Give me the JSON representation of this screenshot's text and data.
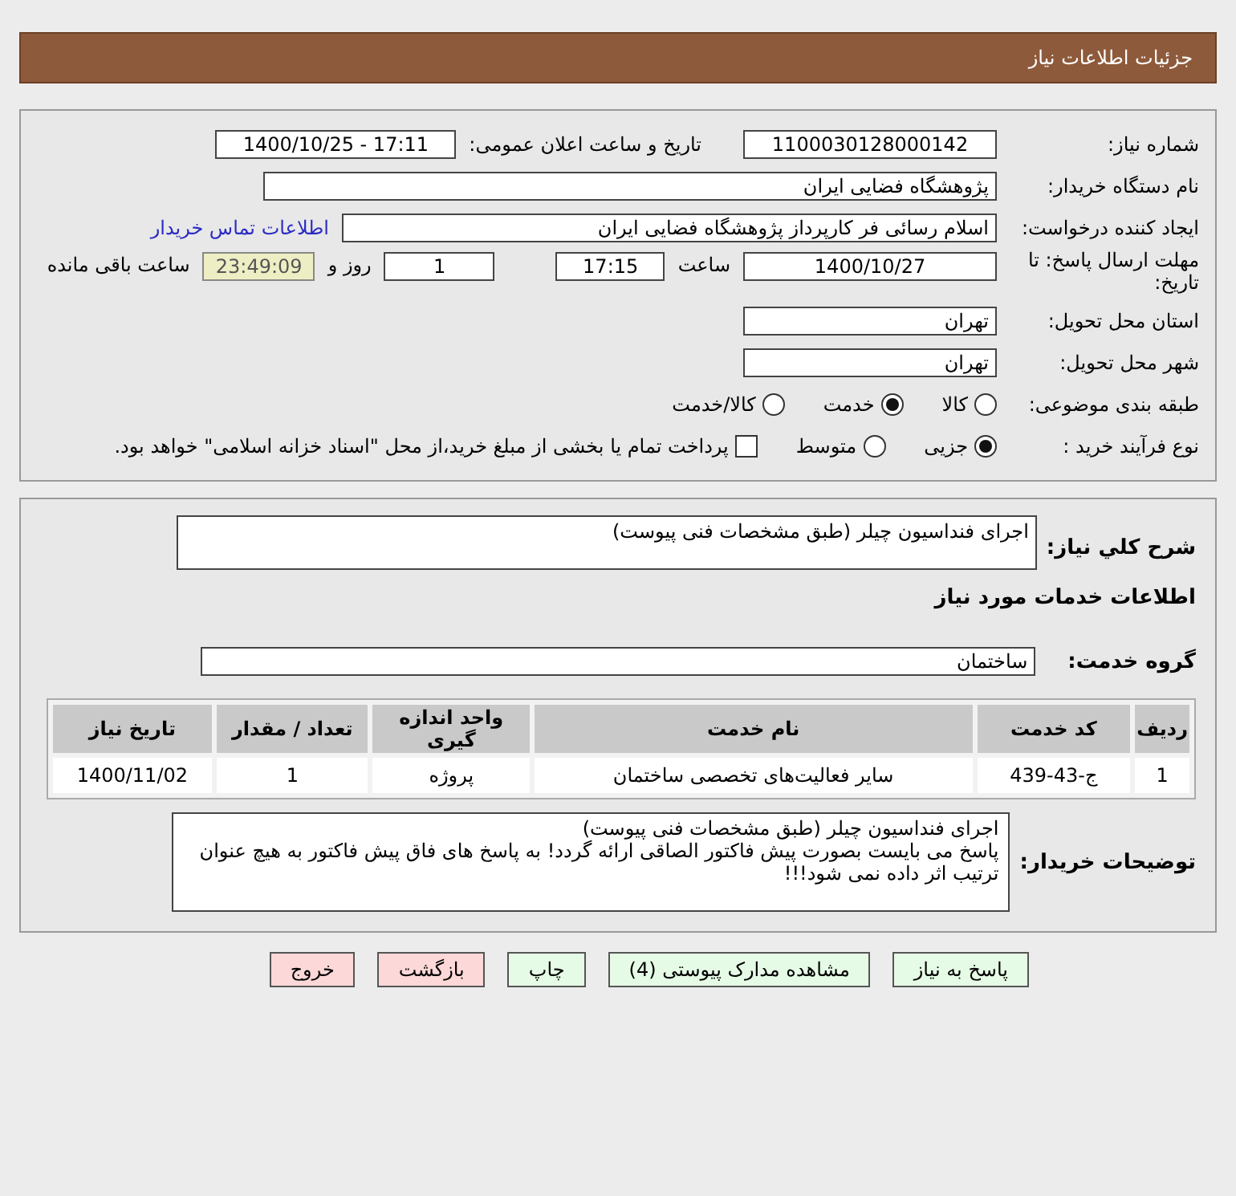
{
  "header": {
    "title": "جزئیات اطلاعات نیاز"
  },
  "details": {
    "need_number": {
      "label": "شماره نیاز:",
      "value": "1100030128000142"
    },
    "announce": {
      "label": "تاریخ و ساعت اعلان عمومی:",
      "value": "1400/10/25 - 17:11"
    },
    "buyer": {
      "label": "نام دستگاه خریدار:",
      "value": "پژوهشگاه فضایی ایران"
    },
    "requester": {
      "label": "ایجاد کننده درخواست:",
      "value": "اسلام رسائی فر کارپرداز پژوهشگاه فضایی ایران",
      "link": "اطلاعات تماس خریدار"
    },
    "deadline": {
      "label": "مهلت ارسال پاسخ: تا تاریخ:",
      "date": "1400/10/27",
      "time_label": "ساعت",
      "time": "17:15",
      "days": "1",
      "days_label": "روز و",
      "remaining": "23:49:09",
      "remaining_label": "ساعت باقی مانده"
    },
    "province": {
      "label": "استان محل تحویل:",
      "value": "تهران"
    },
    "city": {
      "label": "شهر محل تحویل:",
      "value": "تهران"
    },
    "category": {
      "label": "طبقه بندی موضوعی:",
      "options": [
        {
          "label": "کالا",
          "selected": false
        },
        {
          "label": "خدمت",
          "selected": true
        },
        {
          "label": "کالا/خدمت",
          "selected": false
        }
      ]
    },
    "process": {
      "label": "نوع فرآیند خرید :",
      "options": [
        {
          "label": "جزیی",
          "selected": true
        },
        {
          "label": "متوسط",
          "selected": false
        }
      ],
      "payment": {
        "label": "پرداخت تمام یا بخشی از مبلغ خرید،از محل \"اسناد خزانه اسلامی\" خواهد بود.",
        "checked": false
      }
    }
  },
  "services": {
    "summary": {
      "label": "شرح کلي نیاز:",
      "value": "اجرای فنداسیون چیلر (طبق مشخصات فنی پیوست)"
    },
    "section_title": "اطلاعات خدمات مورد نیاز",
    "group": {
      "label": "گروه خدمت:",
      "value": "ساختمان"
    },
    "table": {
      "columns": [
        "ردیف",
        "کد خدمت",
        "نام خدمت",
        "واحد اندازه گیری",
        "تعداد / مقدار",
        "تاریخ نیاز"
      ],
      "rows": [
        [
          "1",
          "ج-43-439",
          "سایر فعالیت‌های تخصصی ساختمان",
          "پروژه",
          "1",
          "1400/11/02"
        ]
      ]
    },
    "notes": {
      "label": "توضیحات خریدار:",
      "lines": [
        "اجرای فنداسیون چیلر (طبق مشخصات فنی پیوست)",
        "پاسخ می بایست بصورت پیش فاکتور الصاقی ارائه گردد! به پاسخ های فاق پیش فاکتور به هیچ عنوان ترتیب اثر داده نمی شود!!!"
      ]
    }
  },
  "buttons": [
    {
      "label": "پاسخ به نیاز",
      "kind": "action"
    },
    {
      "label": "مشاهده مدارک پیوستی (4)",
      "kind": "action"
    },
    {
      "label": "چاپ",
      "kind": "action"
    },
    {
      "label": "بازگشت",
      "kind": "exit"
    },
    {
      "label": "خروج",
      "kind": "exit"
    }
  ]
}
